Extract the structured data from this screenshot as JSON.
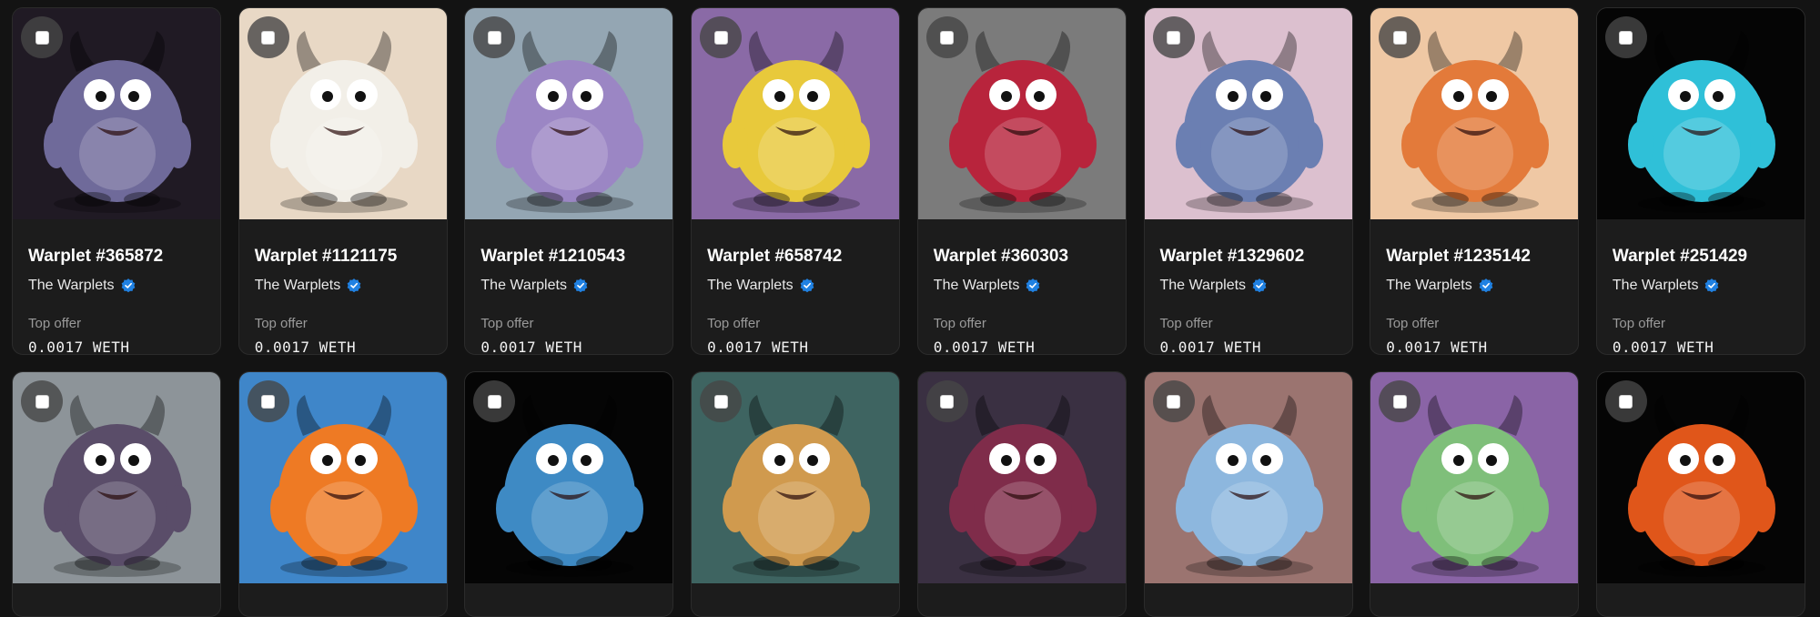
{
  "labels": {
    "top_offer": "Top offer"
  },
  "colors": {
    "page_bg": "#131313",
    "card_bg": "#1c1c1c",
    "verified": "#2081e2"
  },
  "nfts": [
    {
      "name": "Warplet #365872",
      "collection": "The Warplets",
      "offer": "0.0017 WETH",
      "bg": "#201a24",
      "body": "#6f6a9a",
      "icon": "horned-demon-illustration"
    },
    {
      "name": "Warplet #1121175",
      "collection": "The Warplets",
      "offer": "0.0017 WETH",
      "bg": "#e8d8c5",
      "body": "#f2efe8",
      "icon": "chicken-illustration"
    },
    {
      "name": "Warplet #1210543",
      "collection": "The Warplets",
      "offer": "0.0017 WETH",
      "bg": "#94a6b3",
      "body": "#9b86c4",
      "icon": "winged-deer-illustration"
    },
    {
      "name": "Warplet #658742",
      "collection": "The Warplets",
      "offer": "0.0017 WETH",
      "bg": "#8a6aa6",
      "body": "#e8c93b",
      "icon": "rainbow-swirl-illustration"
    },
    {
      "name": "Warplet #360303",
      "collection": "The Warplets",
      "offer": "0.0017 WETH",
      "bg": "#7b7b7b",
      "body": "#b8243c",
      "icon": "red-monster-illustration"
    },
    {
      "name": "Warplet #1329602",
      "collection": "The Warplets",
      "offer": "0.0017 WETH",
      "bg": "#dcc0cf",
      "body": "#6b7fb2",
      "icon": "armored-creature-illustration"
    },
    {
      "name": "Warplet #1235142",
      "collection": "The Warplets",
      "offer": "0.0017 WETH",
      "bg": "#efc8a4",
      "body": "#e37a3a",
      "icon": "fox-mage-illustration"
    },
    {
      "name": "Warplet #251429",
      "collection": "The Warplets",
      "offer": "0.0017 WETH",
      "bg": "#050505",
      "body": "#2fc0d8",
      "icon": "cyan-monster-illustration"
    },
    {
      "bg": "#8d9499",
      "body": "#5a4d69",
      "icon": "purple-brute-illustration"
    },
    {
      "bg": "#3f86c9",
      "body": "#ee7a24",
      "icon": "orange-fox-illustration"
    },
    {
      "bg": "#050505",
      "body": "#3e8ac4",
      "icon": "goggle-gunslinger-illustration"
    },
    {
      "bg": "#3e6461",
      "body": "#d09a4e",
      "icon": "leopard-illustration"
    },
    {
      "bg": "#3a3042",
      "body": "#7f2c4a",
      "icon": "lightning-demon-illustration"
    },
    {
      "bg": "#9b7470",
      "body": "#8db7de",
      "icon": "blue-boxer-illustration"
    },
    {
      "bg": "#8a64a6",
      "body": "#7fbf7a",
      "icon": "green-frog-illustration"
    },
    {
      "bg": "#050505",
      "body": "#e0561a",
      "icon": "flame-skull-illustration"
    }
  ]
}
